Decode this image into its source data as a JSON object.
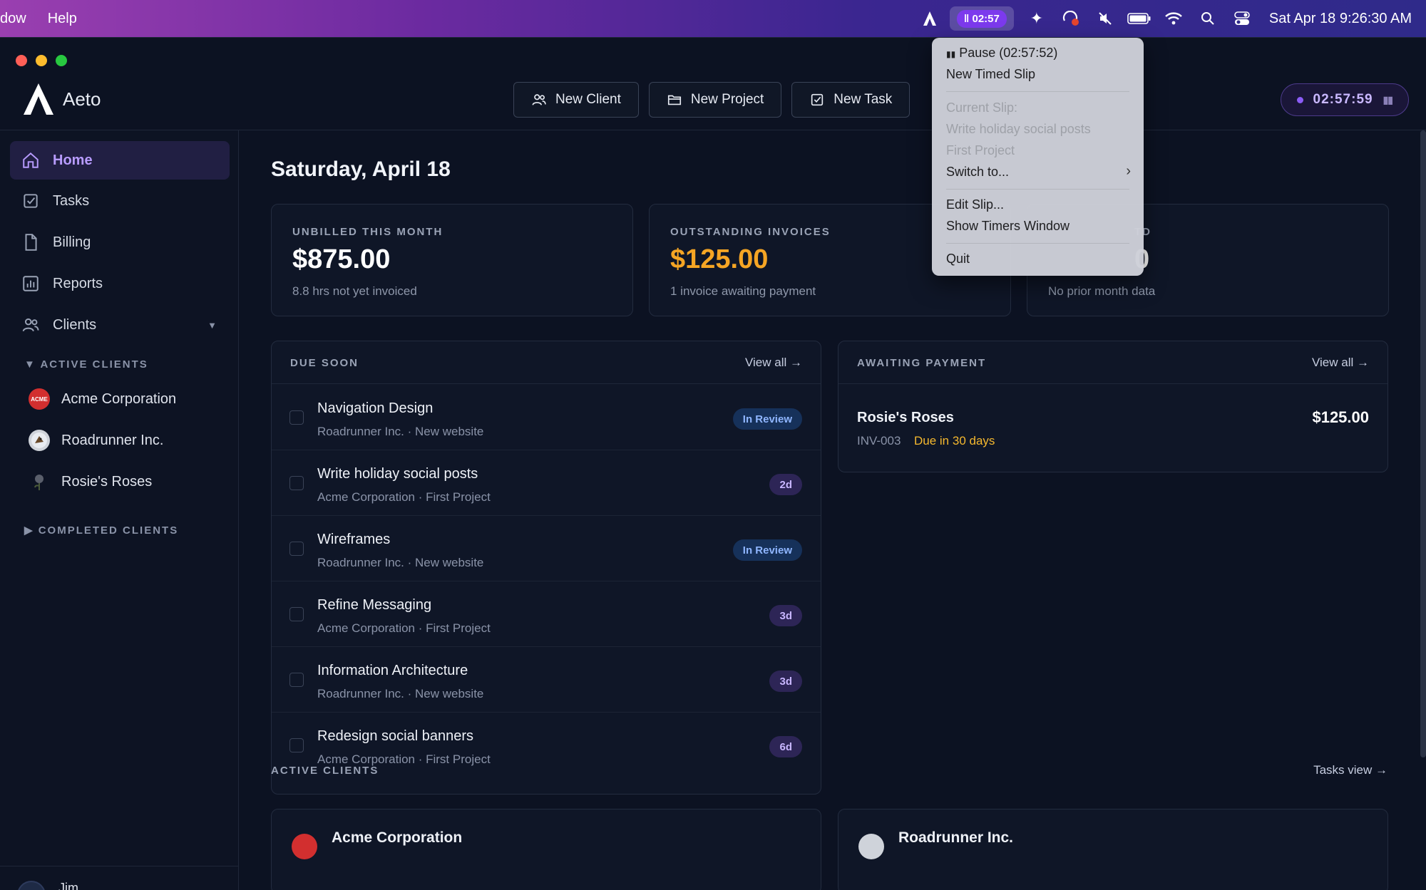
{
  "menubar": {
    "left_items": [
      "dow",
      "Help"
    ],
    "timer_label": "02:57",
    "clock": "Sat Apr 18  9:26:30 AM",
    "icons": [
      "aeto-icon",
      "timer-pill",
      "sparkle-icon",
      "sync-icon",
      "mute-icon",
      "battery-icon",
      "wifi-icon",
      "search-icon",
      "control-center-icon"
    ]
  },
  "window": {
    "brand_name": "Aeto",
    "actions": {
      "new_client": "New Client",
      "new_project": "New Project",
      "new_task": "New Task"
    },
    "timer": "02:57:59"
  },
  "sidebar": {
    "items": [
      {
        "label": "Home",
        "icon": "home-icon"
      },
      {
        "label": "Tasks",
        "icon": "checkbox-icon"
      },
      {
        "label": "Billing",
        "icon": "document-icon"
      },
      {
        "label": "Reports",
        "icon": "chart-icon"
      },
      {
        "label": "Clients",
        "icon": "users-icon"
      }
    ],
    "active_clients_label": "ACTIVE CLIENTS",
    "active_clients": [
      {
        "name": "Acme Corporation",
        "logo_text": "ACME",
        "logo_color": "#d22f2f"
      },
      {
        "name": "Roadrunner Inc.",
        "logo_text": "",
        "logo_color": "#cfd3da"
      },
      {
        "name": "Rosie's Roses",
        "logo_text": "",
        "logo_color": "#3a3f4a"
      }
    ],
    "completed_clients_label": "COMPLETED CLIENTS",
    "user_name": "Jim"
  },
  "main": {
    "title": "Saturday, April 18",
    "stats": [
      {
        "label": "UNBILLED THIS MONTH",
        "value": "$875.00",
        "sub": "8.8 hrs not yet invoiced",
        "color": "#ffffff"
      },
      {
        "label": "OUTSTANDING INVOICES",
        "value": "$125.00",
        "sub": "1 invoice awaiting payment",
        "color": "#f5a524"
      },
      {
        "label": "TD",
        "value": "0",
        "sub": "No prior month data",
        "color": "#ffffff"
      }
    ],
    "due_soon": {
      "title": "DUE SOON",
      "link": "View all →",
      "tasks": [
        {
          "title": "Navigation Design",
          "meta": "Roadrunner Inc. · New website",
          "badge": "In Review",
          "badge_type": "review"
        },
        {
          "title": "Write holiday social posts",
          "meta": "Acme Corporation · First Project",
          "badge": "2d",
          "badge_type": "days"
        },
        {
          "title": "Wireframes",
          "meta": "Roadrunner Inc. · New website",
          "badge": "In Review",
          "badge_type": "review"
        },
        {
          "title": "Refine Messaging",
          "meta": "Acme Corporation · First Project",
          "badge": "3d",
          "badge_type": "days"
        },
        {
          "title": "Information Architecture",
          "meta": "Roadrunner Inc. · New website",
          "badge": "3d",
          "badge_type": "days"
        },
        {
          "title": "Redesign social banners",
          "meta": "Acme Corporation · First Project",
          "badge": "6d",
          "badge_type": "days"
        }
      ]
    },
    "awaiting_payment": {
      "title": "AWAITING PAYMENT",
      "link": "View all →",
      "client": "Rosie's Roses",
      "amount": "$125.00",
      "invoice": "INV-003",
      "due": "Due in 30 days"
    },
    "active_clients": {
      "label": "ACTIVE CLIENTS",
      "link": "Tasks view →",
      "cards": [
        {
          "name": "Acme Corporation"
        },
        {
          "name": "Roadrunner Inc."
        }
      ]
    }
  },
  "dropdown": {
    "pause": "Pause (02:57:52)",
    "new_timed_slip": "New Timed Slip",
    "current_slip_label": "Current Slip:",
    "current_slip_task": "Write holiday social posts",
    "current_slip_project": "First Project",
    "switch_to": "Switch to...",
    "edit_slip": "Edit Slip...",
    "show_timers": "Show Timers Window",
    "quit": "Quit"
  }
}
